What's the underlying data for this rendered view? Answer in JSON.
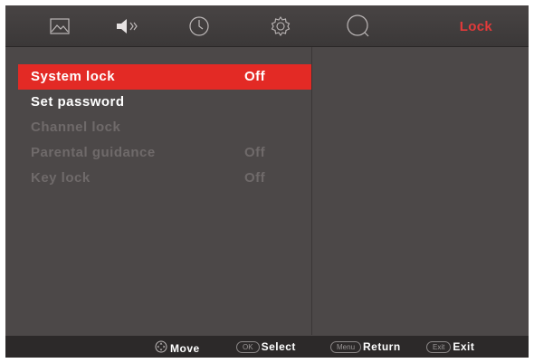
{
  "header": {
    "tabs": [
      {
        "name": "picture",
        "icon": "picture-icon"
      },
      {
        "name": "sound",
        "icon": "speaker-icon"
      },
      {
        "name": "time",
        "icon": "clock-icon"
      },
      {
        "name": "setup",
        "icon": "gear-icon"
      },
      {
        "name": "lock",
        "icon": "lock-circle-icon"
      }
    ],
    "title": "Lock",
    "accent_color": "#e33a3a"
  },
  "menu": {
    "items": [
      {
        "label": "System lock",
        "value": "Off",
        "state": "selected"
      },
      {
        "label": "Set password",
        "value": "",
        "state": "active"
      },
      {
        "label": "Channel lock",
        "value": "",
        "state": "disabled"
      },
      {
        "label": "Parental guidance",
        "value": "Off",
        "state": "disabled"
      },
      {
        "label": "Key lock",
        "value": "Off",
        "state": "disabled"
      }
    ],
    "highlight_color": "#e32a25"
  },
  "footer": {
    "move_label": "Move",
    "select_key": "OK",
    "select_label": "Select",
    "return_key": "Menu",
    "return_label": "Return",
    "exit_key": "Exit",
    "exit_label": "Exit"
  }
}
